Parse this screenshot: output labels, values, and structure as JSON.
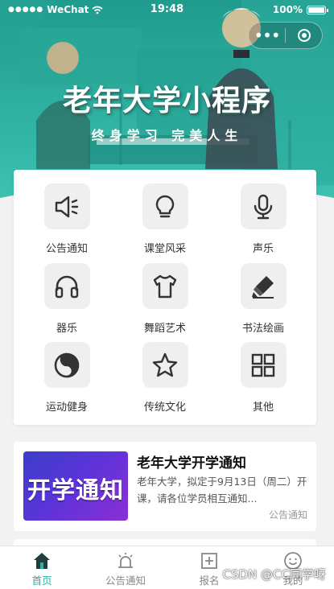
{
  "status_bar": {
    "signal": "●●●●●",
    "carrier": "WeChat",
    "time": "19:48",
    "battery": "100%"
  },
  "banner": {
    "title": "老年大学小程序",
    "subtitle": "终身学习 完美人生"
  },
  "grid": [
    {
      "label": "公告通知",
      "icon": "speaker-icon"
    },
    {
      "label": "课堂风采",
      "icon": "lightbulb-icon"
    },
    {
      "label": "声乐",
      "icon": "microphone-icon"
    },
    {
      "label": "器乐",
      "icon": "headphones-icon"
    },
    {
      "label": "舞蹈艺术",
      "icon": "tshirt-icon"
    },
    {
      "label": "书法绘画",
      "icon": "highlighter-icon"
    },
    {
      "label": "运动健身",
      "icon": "yin-yang-icon"
    },
    {
      "label": "传统文化",
      "icon": "star-icon"
    },
    {
      "label": "其他",
      "icon": "grid-icon"
    }
  ],
  "notice": {
    "thumb_text": "开学通知",
    "title": "老年大学开学通知",
    "description": "老年大学，拟定于9月13日（周二）开课，请各位学员相互通知...",
    "tag": "公告通知"
  },
  "tabbar": [
    {
      "label": "首页",
      "icon": "home-icon",
      "active": true
    },
    {
      "label": "公告通知",
      "icon": "alarm-icon",
      "active": false
    },
    {
      "label": "报名",
      "icon": "plus-box-icon",
      "active": false
    },
    {
      "label": "我的",
      "icon": "smiley-icon",
      "active": false
    }
  ],
  "watermark": "CSDN @CC同学呀",
  "colors": {
    "theme": "#25b3a6",
    "banner_bg": "#2eb3a3",
    "icon_tile": "#efefef"
  }
}
